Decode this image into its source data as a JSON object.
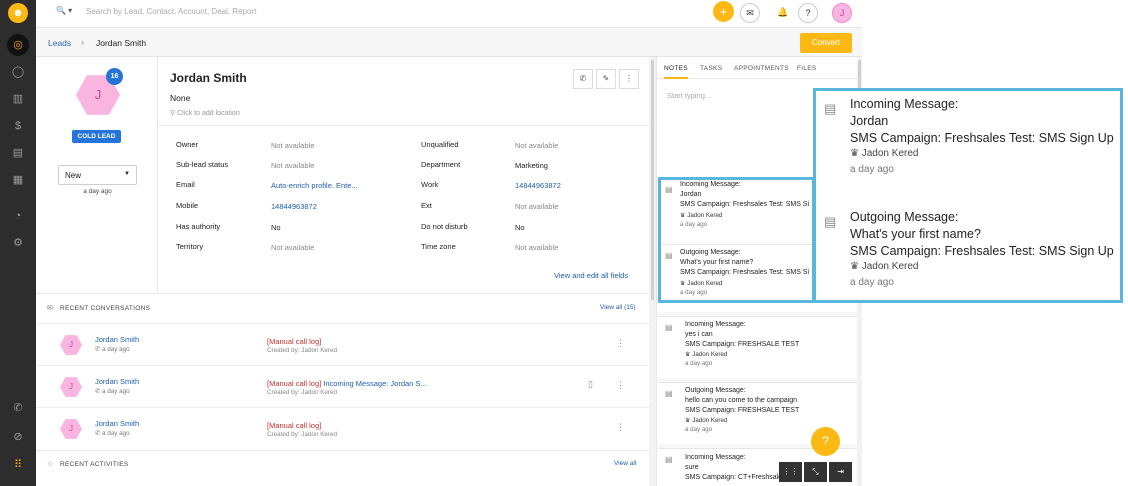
{
  "topbar": {
    "search_prefix": "🔍 ▾",
    "search_placeholder": "Search by Lead, Contact, Account, Deal, Report",
    "add_icon": "+",
    "mail_icon": "✉",
    "bell_icon": "🔔",
    "help_icon": "?",
    "avatar_initial": "J"
  },
  "breadcrumb": {
    "parent": "Leads",
    "separator": "›",
    "current": "Jordan Smith",
    "convert_label": "Convert"
  },
  "profile": {
    "initial": "J",
    "badge_count": "16",
    "cold_label": "COLD LEAD",
    "stage_value": "New",
    "stage_caret": "▼",
    "stage_time": "a day ago"
  },
  "details": {
    "name": "Jordan Smith",
    "subtitle": "None",
    "location_placeholder": "⚲ Click to add location",
    "actions": [
      "✆",
      "✎",
      "⋮"
    ],
    "left_fields": [
      {
        "label": "Owner",
        "value": "Not available"
      },
      {
        "label": "Sub-lead status",
        "value": "Not available"
      },
      {
        "label": "Email",
        "value": "Auto-enrich profile. Ente..."
      },
      {
        "label": "Mobile",
        "value": "14844963872"
      },
      {
        "label": "Has authority",
        "value": "No"
      },
      {
        "label": "Territory",
        "value": "Not available"
      }
    ],
    "right_fields": [
      {
        "label": "Unqualified",
        "value": "Not available"
      },
      {
        "label": "Department",
        "value": "Marketing"
      },
      {
        "label": "Work",
        "value": "14844963872"
      },
      {
        "label": "Ext",
        "value": "Not available"
      },
      {
        "label": "Do not disturb",
        "value": "No"
      },
      {
        "label": "Time zone",
        "value": "Not available"
      }
    ],
    "view_all": "View and edit all fields"
  },
  "conversations": {
    "icon": "✉",
    "title": "RECENT CONVERSATIONS",
    "view_all": "View all (15)",
    "items": [
      {
        "initial": "J",
        "name": "Jordan Smith",
        "time": "✆ a day ago",
        "tag": "[Manual call log]",
        "text": "",
        "creator": "Created by: Jadon Kered",
        "more": "⋮"
      },
      {
        "initial": "J",
        "name": "Jordan Smith",
        "time": "✆ a day ago",
        "tag": "[Manual call log]",
        "text": " Incoming Message: Jordan S...",
        "creator": "Created by: Jadon Kered",
        "more": "⋮",
        "doc": "▯"
      },
      {
        "initial": "J",
        "name": "Jordan Smith",
        "time": "✆ a day ago",
        "tag": "[Manual call log]",
        "text": "",
        "creator": "Created by: Jadon Kered",
        "more": "⋮"
      }
    ]
  },
  "activities": {
    "icon": "☆",
    "title": "RECENT ACTIVITIES",
    "view_all": "View all"
  },
  "sidepanel": {
    "tabs": [
      "NOTES",
      "TASKS",
      "APPOINTMENTS",
      "FILES"
    ],
    "placeholder": "Start typing...",
    "notes": [
      {
        "lines": [
          "Incoming Message:",
          "Jordan",
          "SMS Campaign: Freshsales Test: SMS Si"
        ],
        "author": "♛ Jadon Kered",
        "time": "a day ago"
      },
      {
        "lines": [
          "Outgoing Message:",
          "What's your first name?",
          "SMS Campaign: Freshsales Test: SMS Si"
        ],
        "author": "♛ Jadon Kered",
        "time": "a day ago"
      },
      {
        "lines": [
          "Incoming Message:",
          "yes i can",
          "SMS Campaign: FRESHSALE TEST"
        ],
        "author": "♛ Jadon Kered",
        "time": "a day ago"
      },
      {
        "lines": [
          "Outgoing Message:",
          "hello can you come to the campaign",
          "SMS Campaign: FRESHSALE TEST"
        ],
        "author": "♛ Jadon Kered",
        "time": "a day ago"
      },
      {
        "lines": [
          "Incoming Message:",
          "sure",
          "SMS Campaign: CT+Freshsales"
        ],
        "author": "",
        "time": ""
      }
    ]
  },
  "zoom": {
    "notes": [
      {
        "lines": [
          "Incoming Message:",
          "Jordan",
          "SMS Campaign: Freshsales Test: SMS Sign Up"
        ],
        "author": "♛ Jadon Kered",
        "time": "a day ago"
      },
      {
        "lines": [
          "Outgoing Message:",
          "What's your first name?",
          "SMS Campaign: Freshsales Test: SMS Sign Up"
        ],
        "author": "♛ Jadon Kered",
        "time": "a day ago"
      }
    ]
  },
  "floating": {
    "help": "?",
    "bottom_buttons": [
      "⋮⋮",
      "⤡",
      "⇥"
    ]
  },
  "colors": {
    "accent": "#fdb913",
    "link": "#1f5fae",
    "badge": "#2674d9",
    "highlight": "#5bb6dd"
  }
}
